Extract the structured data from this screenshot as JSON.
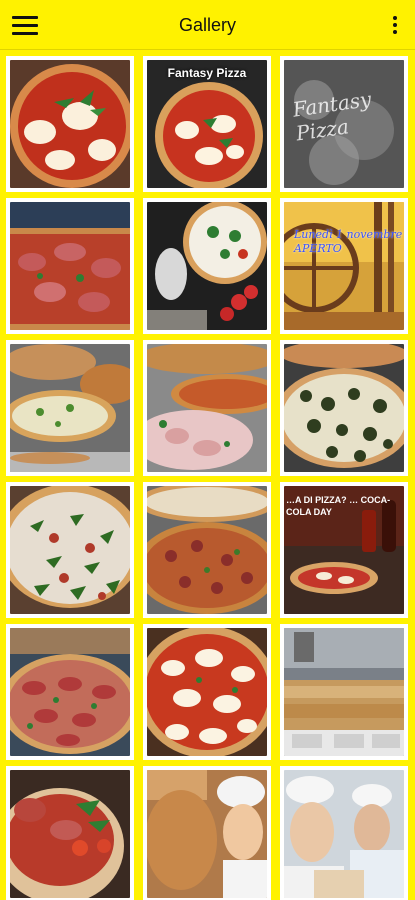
{
  "app": {
    "title": "Gallery"
  },
  "icons": {
    "menu": "hamburger-menu-icon",
    "more": "more-vertical-icon"
  },
  "colors": {
    "accent": "#FFF200",
    "tile_border": "#FFFFFF"
  },
  "gallery": {
    "photos": [
      {
        "kind": "pizza-margherita",
        "caption": ""
      },
      {
        "kind": "pizza-basil",
        "caption": "Fantasy Pizza"
      },
      {
        "kind": "flour-writing",
        "caption": "Fantasy Pizza"
      },
      {
        "kind": "pizza-long-prosciutto",
        "caption": ""
      },
      {
        "kind": "pizza-tomatoes",
        "caption": ""
      },
      {
        "kind": "wood-wheel-sign",
        "caption": "Lunedì 1 novembre APERTO"
      },
      {
        "kind": "pizza-trays",
        "caption": ""
      },
      {
        "kind": "pizza-slices",
        "caption": ""
      },
      {
        "kind": "pizza-spinach",
        "caption": ""
      },
      {
        "kind": "pizza-rucola",
        "caption": ""
      },
      {
        "kind": "pizza-mixed",
        "caption": ""
      },
      {
        "kind": "ad-coca-cola",
        "caption": "…A DI PIZZA? … COCA-COLA DAY"
      },
      {
        "kind": "pizza-prosciutto-tray",
        "caption": ""
      },
      {
        "kind": "pizza-margherita-large",
        "caption": ""
      },
      {
        "kind": "kitchen-counter",
        "caption": ""
      },
      {
        "kind": "pizza-slice-closeup",
        "caption": ""
      },
      {
        "kind": "chef-selfie",
        "caption": ""
      },
      {
        "kind": "chefs-two",
        "caption": ""
      }
    ]
  }
}
